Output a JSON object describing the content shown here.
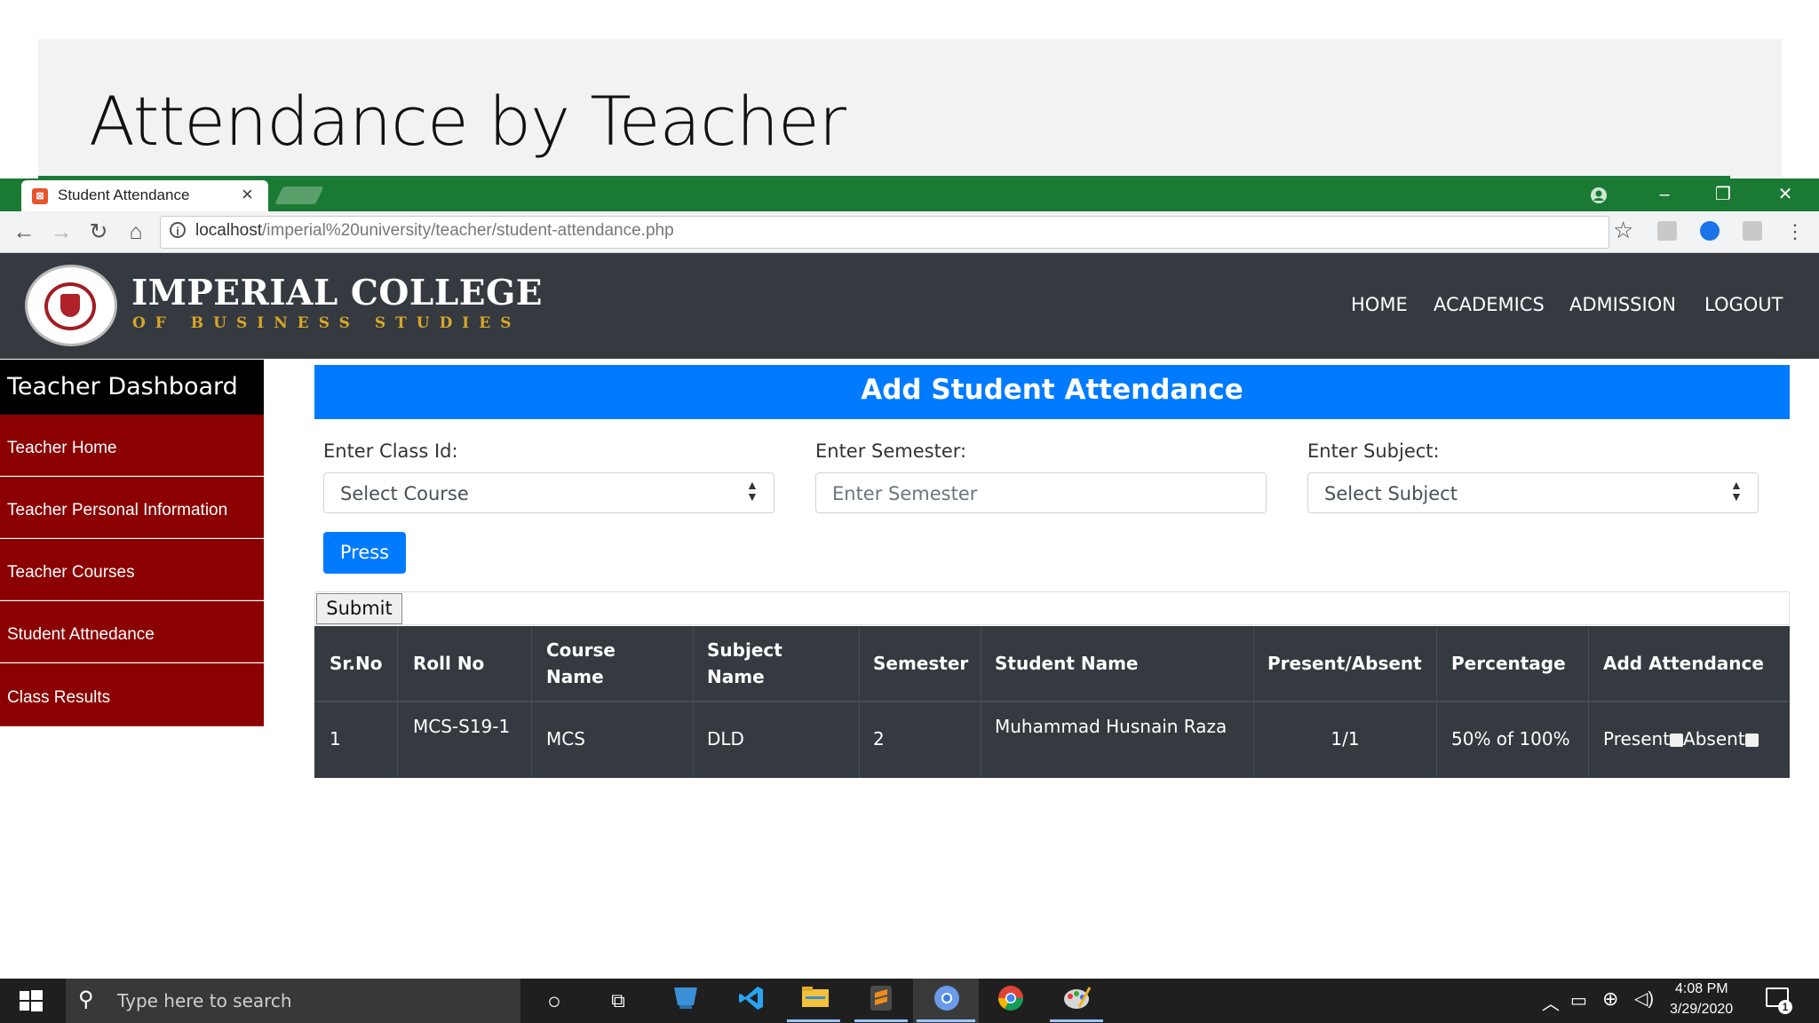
{
  "slide": {
    "title": "Attendance by Teacher"
  },
  "browser": {
    "tab_title": "Student Attendance",
    "url_host": "localhost",
    "url_path": "/imperial%20university/teacher/student-attendance.php"
  },
  "site": {
    "brand_main": "IMPERIAL COLLEGE",
    "brand_sub": "OF BUSINESS STUDIES",
    "nav": [
      "HOME",
      "ACADEMICS",
      "ADMISSION",
      "LOGOUT"
    ]
  },
  "sidebar": {
    "title": "Teacher Dashboard",
    "items": [
      "Teacher Home",
      "Teacher Personal Information",
      "Teacher Courses",
      "Student Attnedance",
      "Class Results"
    ]
  },
  "form": {
    "heading": "Add Student Attendance",
    "class_label": "Enter Class Id:",
    "class_value": "Select Course",
    "semester_label": "Enter Semester:",
    "semester_placeholder": "Enter Semester",
    "subject_label": "Enter Subject:",
    "subject_value": "Select Subject",
    "press_label": "Press",
    "submit_label": "Submit"
  },
  "table": {
    "headers": [
      "Sr.No",
      "Roll No",
      "Course Name",
      "Subject Name",
      "Semester",
      "Student Name",
      "Present/Absent",
      "Percentage",
      "Add Attendance"
    ],
    "rows": [
      [
        "1",
        "MCS-S19-1",
        "MCS",
        "DLD",
        "2",
        "Muhammad Husnain Raza",
        "1/1",
        "50% of 100%"
      ]
    ],
    "present_label": "Present",
    "absent_label": "Absent"
  },
  "taskbar": {
    "search_placeholder": "Type here to search",
    "time": "4:08 PM",
    "date": "3/29/2020",
    "notification_count": "1"
  },
  "colors": {
    "primary": "#007bff",
    "sidebar": "#8b0000",
    "header": "#343a40",
    "browser_frame": "#1a7a33",
    "brand_gold": "#d9a629"
  }
}
